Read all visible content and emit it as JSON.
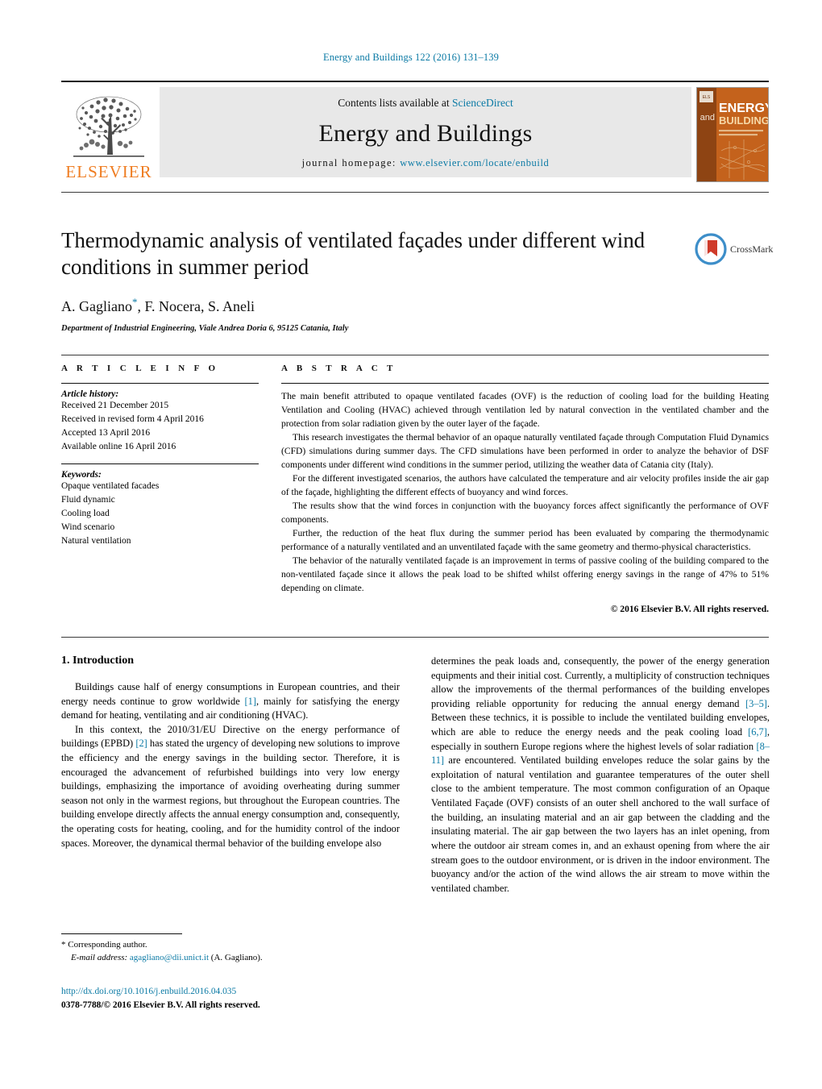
{
  "running_head": "Energy and Buildings 122 (2016) 131–139",
  "masthead": {
    "publisher_name": "ELSEVIER",
    "contents_prefix": "Contents lists available at ",
    "contents_link": "ScienceDirect",
    "journal_name": "Energy and Buildings",
    "homepage_prefix": "journal homepage:",
    "homepage_url": "www.elsevier.com/locate/enbuild",
    "cover": {
      "line_and": "and",
      "line_energy": "ENERGY",
      "line_buildings": "BUILDINGS"
    }
  },
  "article": {
    "title": "Thermodynamic analysis of ventilated façades under different wind conditions in summer period",
    "authors": "A. Gagliano",
    "authors_rest": ", F. Nocera, S. Aneli",
    "affiliation": "Department of Industrial Engineering, Viale Andrea Doria 6, 95125 Catania, Italy",
    "crossmark_label": "CrossMark"
  },
  "article_info": {
    "heading": "A R T I C L E   I N F O",
    "history_heading": "Article history:",
    "history": [
      "Received 21 December 2015",
      "Received in revised form 4 April 2016",
      "Accepted 13 April 2016",
      "Available online 16 April 2016"
    ],
    "keywords_heading": "Keywords:",
    "keywords": [
      "Opaque ventilated facades",
      "Fluid dynamic",
      "Cooling load",
      "Wind scenario",
      "Natural ventilation"
    ]
  },
  "abstract": {
    "heading": "A B S T R A C T",
    "paragraphs": [
      "The main benefit attributed to opaque ventilated facades (OVF) is the reduction of cooling load for the building Heating Ventilation and Cooling (HVAC) achieved through ventilation led by natural convection in the ventilated chamber and the protection from solar radiation given by the outer layer of the façade.",
      "This research investigates the thermal behavior of an opaque naturally ventilated façade through Computation Fluid Dynamics (CFD) simulations during summer days. The CFD simulations have been performed in order to analyze the behavior of DSF components under different wind conditions in the summer period, utilizing the weather data of Catania city (Italy).",
      "For the different investigated scenarios, the authors have calculated the temperature and air velocity profiles inside the air gap of the façade, highlighting the different effects of buoyancy and wind forces.",
      "The results show that the wind forces in conjunction with the buoyancy forces affect significantly the performance of OVF components.",
      "Further, the reduction of the heat flux during the summer period has been evaluated by comparing the thermodynamic performance of a naturally ventilated and an unventilated façade with the same geometry and thermo-physical characteristics.",
      "The behavior of the naturally ventilated façade is an improvement in terms of passive cooling of the building compared to the non-ventilated façade since it allows the peak load to be shifted whilst offering energy savings in the range of 47% to 51% depending on climate."
    ],
    "copyright": "© 2016 Elsevier B.V. All rights reserved."
  },
  "introduction": {
    "heading": "1.  Introduction",
    "left_p1_a": "Buildings cause half of energy consumptions in European countries, and their energy needs continue to grow worldwide ",
    "left_p1_ref": "[1]",
    "left_p1_b": ", mainly for satisfying the energy demand for heating, ventilating and air conditioning (HVAC).",
    "left_p2_a": "In this context, the 2010/31/EU Directive on the energy performance of buildings (EPBD) ",
    "left_p2_ref": "[2]",
    "left_p2_b": " has stated the urgency of developing new solutions to improve the efficiency and the energy savings in the building sector. Therefore, it is encouraged the advancement of refurbished buildings into very low energy buildings, emphasizing the importance of avoiding overheating during summer season not only in the warmest regions, but throughout the European countries. The building envelope directly affects the annual energy consumption and, consequently, the operating costs for heating, cooling, and for the humidity control of the indoor spaces. Moreover, the dynamical thermal behavior of the building envelope also",
    "right_a": "determines the peak loads and, consequently, the power of the energy generation equipments and their initial cost. Currently, a multiplicity of construction techniques allow the improvements of the thermal performances of the building envelopes providing reliable opportunity for reducing the annual energy demand ",
    "right_ref1": "[3–5]",
    "right_b": ". Between these technics, it is possible to include the ventilated building envelopes, which are able to reduce the energy needs and the peak cooling load ",
    "right_ref2": "[6,7]",
    "right_c": ", especially in southern Europe regions where the highest levels of solar radiation ",
    "right_ref3": "[8–11]",
    "right_d": " are encountered. Ventilated building envelopes reduce the solar gains by the exploitation of natural ventilation and guarantee temperatures of the outer shell close to the ambient temperature. The most common configuration of an Opaque Ventilated Façade (OVF) consists of an outer shell anchored to the wall surface of the building, an insulating material and an air gap between the cladding and the insulating material. The air gap between the two layers has an inlet opening, from where the outdoor air stream comes in, and an exhaust opening from where the air stream goes to the outdoor environment, or is driven in the indoor environment. The buoyancy and/or the action of the wind allows the air stream to move within the ventilated chamber."
  },
  "footer": {
    "corresponding": "*  Corresponding author.",
    "email_label": "E-mail address:",
    "email": "agagliano@dii.unict.it",
    "email_suffix": " (A. Gagliano).",
    "doi": "http://dx.doi.org/10.1016/j.enbuild.2016.04.035",
    "issn_line": "0378-7788/© 2016 Elsevier B.V. All rights reserved."
  },
  "colors": {
    "link": "#0b7aa5",
    "elsevier_orange": "#ef7d22",
    "band_gray": "#e8e8e8"
  }
}
